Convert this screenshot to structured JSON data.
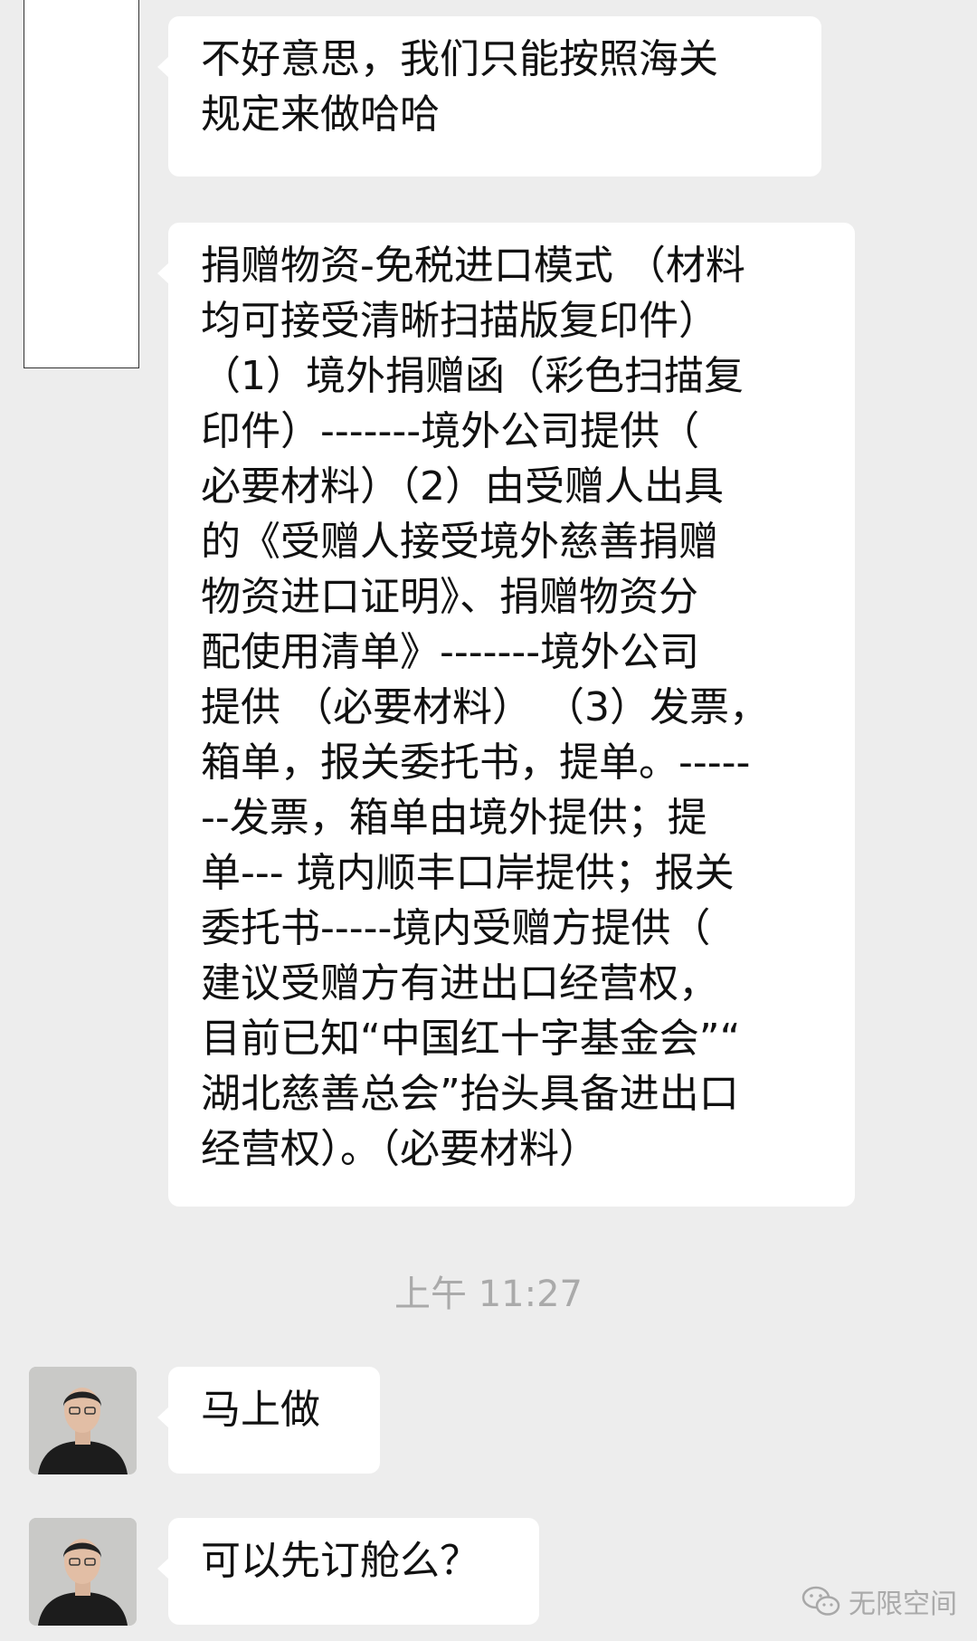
{
  "conversation": {
    "messages": [
      {
        "text": "不好意思，我们只能按照海关\n规定来做哈哈"
      },
      {
        "text": "捐赠物资-免税进口模式 （材料\n均可接受清晰扫描版复印件）\n（1）境外捐赠函（彩色扫描复\n印件）-------境外公司提供（\n必要材料）（2）由受赠人出具\n的《受赠人接受境外慈善捐赠\n物资进口证明》、捐赠物资分\n配使用清单》-------境外公司\n提供 （必要材料） （3）发票，\n箱单，报关委托书，提单。-----\n--发票，箱单由境外提供；提\n单--- 境内顺丰口岸提供；报关\n委托书-----境内受赠方提供（\n建议受赠方有进出口经营权，\n目前已知“中国红十字基金会”“\n湖北慈善总会”抬头具备进出口\n经营权）。（必要材料）"
      },
      {
        "timestamp": "上午 11:27"
      },
      {
        "text": "马上做"
      },
      {
        "text": "可以先订舱么？"
      }
    ]
  },
  "watermark": {
    "text": "无限空间",
    "icon": "wechat-icon"
  },
  "colors": {
    "background": "#ededed",
    "bubble": "#ffffff",
    "text": "#111111",
    "timestamp": "#aaaaaa"
  }
}
